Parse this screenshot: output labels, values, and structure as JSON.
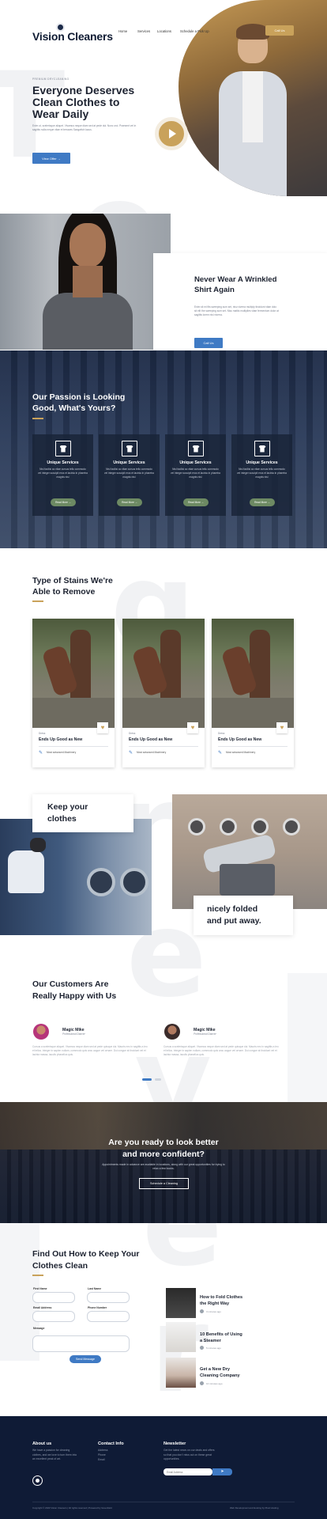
{
  "header": {
    "logo_text": "Vision Cleaners",
    "nav": [
      "Home",
      "Services",
      "Locations",
      "Schedule a Pick Up"
    ],
    "cta_label": "Call Us"
  },
  "hero": {
    "eyebrow": "PREMIUM DRYCLEANING",
    "title_lines": [
      "Everyone Deserves",
      "Clean Clothes to",
      "Wear Daily"
    ],
    "body": "Enim ut, scelerisque aliquet. Vivamus neque diam sed at pede dui. Nunc orci. Praesent vel in sagittis nulla neque vitae et terraces Sangwitch lacus.",
    "button": "View Offer →"
  },
  "wrinkle": {
    "title_lines": [
      "Never Wear A Wrinkled",
      "Shirt Again"
    ],
    "body": "Enim sit mi fits sweeping sum set, nisu viverra multiply tincidunt vitae dolo sit elit the sweeping sum set. Nisu mattis multiplies vitae fermentum dolor at sagittis lorem nisi viverra.",
    "button": "Call Us"
  },
  "passion": {
    "title_lines": [
      "Our Passion is Looking",
      "Good, What's Yours?"
    ],
    "cards": [
      {
        "title": "Unique Services",
        "body": "Nisl facilisi ac vitae cursus tellu commodo vel integer suscipit eros et lacinia in pharetra magnis nisi",
        "link": "Read More →"
      },
      {
        "title": "Unique Services",
        "body": "Nisl facilisi ac vitae cursus tellu commodo vel integer suscipit eros et lacinia in pharetra magnis nisi",
        "link": "Read More →"
      },
      {
        "title": "Unique Services",
        "body": "Nisl facilisi ac vitae cursus tellu commodo vel integer suscipit eros et lacinia in pharetra magnis nisi",
        "link": "Read More →"
      },
      {
        "title": "Unique Services",
        "body": "Nisl facilisi ac vitae cursus tellu commodo vel integer suscipit eros et lacinia in pharetra magnis nisi",
        "link": "Read More →"
      }
    ]
  },
  "stains": {
    "title_lines": [
      "Type of Stains We're",
      "Able to Remove"
    ],
    "cards": [
      {
        "tag": "Dress",
        "title": "Ends Up Good as New",
        "link": "Most advanced Machinery"
      },
      {
        "tag": "Dress",
        "title": "Ends Up Good as New",
        "link": "Most advanced Machinery"
      },
      {
        "tag": "Dress",
        "title": "Ends Up Good as New",
        "link": "Most advanced Machinery"
      }
    ]
  },
  "clothes": {
    "keep_lines": [
      "Keep your",
      "clothes"
    ],
    "folded_lines": [
      "nicely folded",
      "and put away."
    ]
  },
  "testimonials": {
    "title_lines": [
      "Our Customers Are",
      "Really Happy with Us"
    ],
    "items": [
      {
        "name": "Magic Mike",
        "role": "Professional Dancer",
        "quote": "Cursus a scelerisque aliquet. Vivamus neque diam sed at pede quisque dui. Mauris nec in sagittis a leo et tellus. Integer in sapien nullam, commodo quis arcu augue vel ornare. Dui congue at tincidunt vel et lacinia massa, iaculis phasellus quis."
      },
      {
        "name": "Magic Mike",
        "role": "Professional Dancer",
        "quote": "Cursus a scelerisque aliquet. Vivamus neque diam sed at pede quisque dui. Mauris nec in sagittis a leo et tellus. Integer in sapien nullam, commodo quis arcu augue vel ornare. Dui congue at tincidunt vel et lacinia massa, iaculis phasellus quis."
      }
    ]
  },
  "cta_band": {
    "title_lines": [
      "Are you ready to look better",
      "and more confident?"
    ],
    "body": "Appointments made in advance are available in locations, along with our great opportunities for trying to relax a few books.",
    "button": "Schedule a Cleaning"
  },
  "contact": {
    "title_lines": [
      "Find Out How to Keep Your",
      "Clothes Clean"
    ],
    "labels": {
      "first": "First Name",
      "last": "Last Name",
      "email": "Email Address",
      "phone": "Phone Number",
      "message": "Message"
    },
    "button": "Send Message",
    "posts": [
      {
        "title_lines": [
          "How to Fold Clothes",
          "the Right Way"
        ],
        "date": "3 minutes ago"
      },
      {
        "title_lines": [
          "10 Benefits of Using",
          "a Steamer"
        ],
        "date": "5 minutes ago"
      },
      {
        "title_lines": [
          "Get a New Dry",
          "Cleaning Company"
        ],
        "date": "10 minutes ago"
      }
    ]
  },
  "footer": {
    "about_title": "About us",
    "about_body": "We have a passion for cleaning clothes, and we love to turn them into an excellent peak of art.",
    "contact_title": "Contact Info",
    "contact_items": [
      "Address",
      "Phone",
      "Email"
    ],
    "news_title": "Newsletter",
    "news_body": "Get the latest news on our deals and offers so that you don't miss out on these great opportunities.",
    "news_placeholder": "Email Address",
    "copyright": "Copyright © 2023 Vision Cleaners | All rights reserved | Powered by Greenfield",
    "right_text": "Web Development and Hosting by Pixel Hosting"
  },
  "colors": {
    "accent_blue": "#3f7ac4",
    "gold": "#c9a25b",
    "navy": "#0f1b36"
  }
}
